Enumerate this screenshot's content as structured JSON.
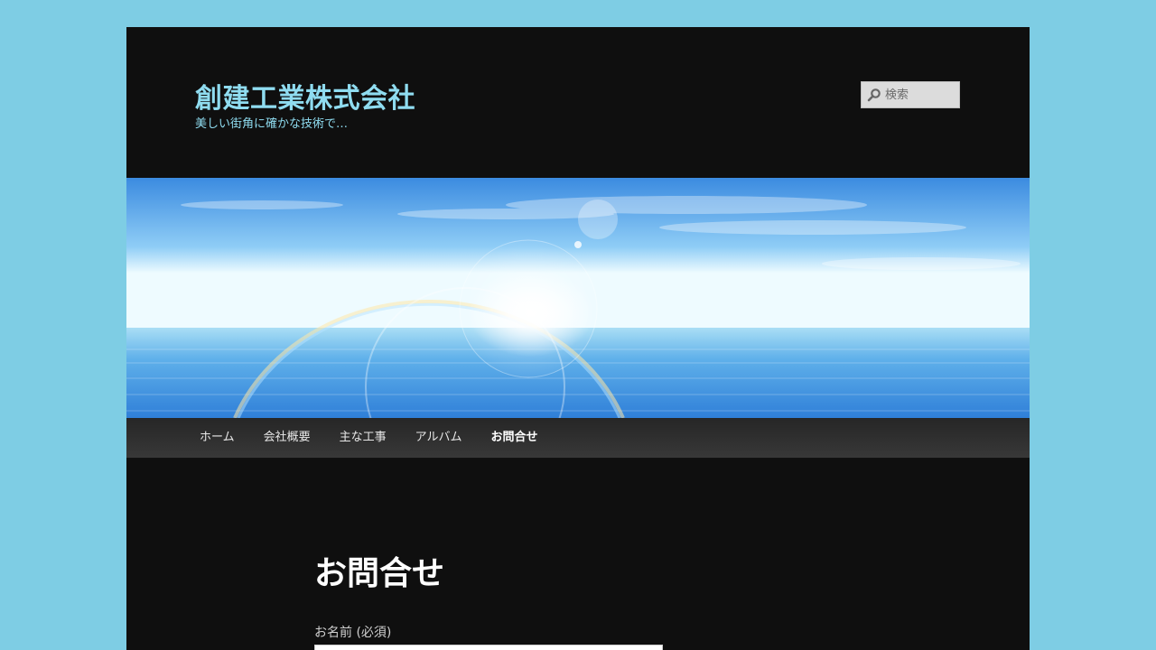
{
  "site": {
    "title": "創建工業株式会社",
    "description": "美しい街角に確かな技術で…"
  },
  "search": {
    "placeholder": "検索",
    "icon": "search-icon"
  },
  "nav": {
    "items": [
      {
        "label": "ホーム"
      },
      {
        "label": "会社概要"
      },
      {
        "label": "主な工事"
      },
      {
        "label": "アルバム"
      },
      {
        "label": "お問合せ",
        "current": true
      }
    ]
  },
  "content": {
    "title": "お問合せ",
    "form": {
      "name_label": "お名前 (必須)",
      "name_value": ""
    }
  },
  "colors": {
    "page_background": "#7ecde4",
    "site_background": "#0f0f0f",
    "title_color": "#8fdcf0",
    "nav_background": "#333333"
  }
}
